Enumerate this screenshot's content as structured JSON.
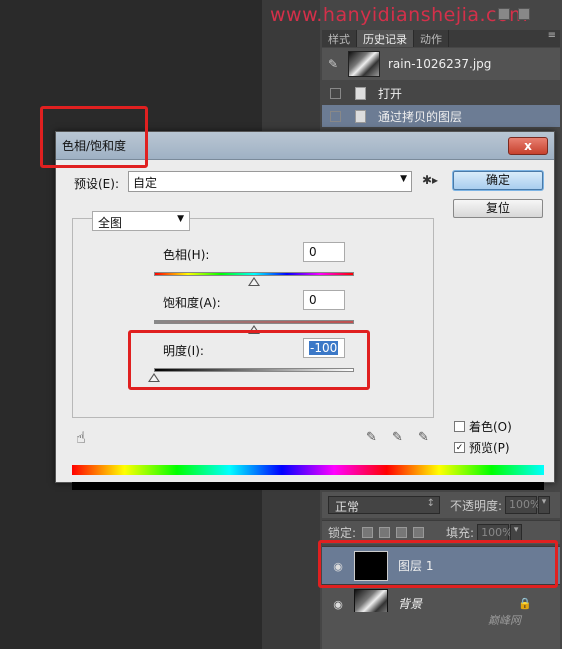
{
  "watermark": "www.hanyidianshejia.com",
  "history_panel": {
    "tabs": [
      "样式",
      "历史记录",
      "动作"
    ],
    "active_tab": "历史记录",
    "menu_icon": "≡",
    "snapshot_label": "rain-1026237.jpg",
    "items": [
      {
        "label": "打开",
        "selected": false
      },
      {
        "label": "通过拷贝的图层",
        "selected": true
      }
    ]
  },
  "dialog": {
    "title": "色相/饱和度",
    "close_label": "x",
    "preset_label": "预设(E):",
    "preset_value": "自定",
    "ok_label": "确定",
    "reset_label": "复位",
    "range_value": "全图",
    "hue": {
      "label": "色相(H):",
      "value": "0",
      "level": 0.5
    },
    "saturation": {
      "label": "饱和度(A):",
      "value": "0",
      "level": 0.5
    },
    "lightness": {
      "label": "明度(I):",
      "value": "-100",
      "level": 0.0
    },
    "colorize_label": "着色(O)",
    "colorize_checked": false,
    "preview_label": "预览(P)",
    "preview_checked": true,
    "result_color": "#000000"
  },
  "layers_panel": {
    "blend_mode": "正常",
    "opacity_label": "不透明度:",
    "opacity_value": "100%",
    "lock_label": "锁定:",
    "fill_label": "填充:",
    "fill_value": "100%",
    "layers": [
      {
        "name": "图层 1",
        "selected": true,
        "thumb": "black"
      },
      {
        "name": "背景",
        "selected": false,
        "thumb": "photo",
        "locked": true
      }
    ]
  },
  "corner_logo": "巅峰网"
}
